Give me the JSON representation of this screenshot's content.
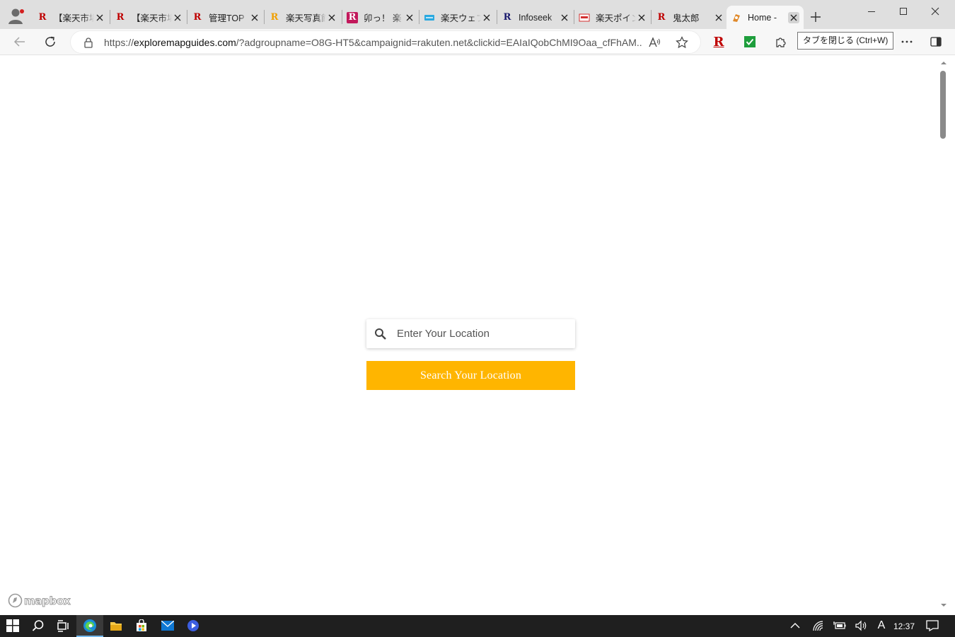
{
  "browser": {
    "tabs": [
      {
        "title": "【楽天市場】",
        "favicon": "rakuten-r-icon",
        "favicon_color": "#bf0000",
        "favicon_letter": "R"
      },
      {
        "title": "【楽天市場】",
        "favicon": "rakuten-r-icon",
        "favicon_color": "#bf0000",
        "favicon_letter": "R"
      },
      {
        "title": "管理TOP",
        "favicon": "rakuten-r-icon",
        "favicon_color": "#bf0000",
        "favicon_letter": "R"
      },
      {
        "title": "楽天写真館",
        "favicon": "rakuten-r-orange-icon",
        "favicon_color": "#f0a000",
        "favicon_letter": "R"
      },
      {
        "title": "卯っ！ 楽",
        "favicon": "rakuten-r-pink-icon",
        "favicon_color": "#c2185b",
        "favicon_letter": "R"
      },
      {
        "title": "楽天ウェブ",
        "favicon": "rakuten-web-icon",
        "favicon_color": "#2aa9e0",
        "favicon_letter": ""
      },
      {
        "title": "Infoseek",
        "favicon": "infoseek-r-icon",
        "favicon_color": "#1a1a6e",
        "favicon_letter": "R"
      },
      {
        "title": "楽天ポイント",
        "favicon": "rakuten-point-icon",
        "favicon_color": "#d32f2f",
        "favicon_letter": ""
      },
      {
        "title": "鬼太郎",
        "favicon": "rakuten-r-icon",
        "favicon_color": "#bf0000",
        "favicon_letter": "R"
      },
      {
        "title": "Home -",
        "favicon": "map-pin-icon",
        "favicon_color": "#e08a2c",
        "favicon_letter": "",
        "active": true
      }
    ],
    "address": {
      "host": "exploremapguides.com",
      "prefix": "https://",
      "rest": "/?adgroupname=O8G-HT5&campaignid=rakuten.net&clickid=EAIaIQobChMI9Oaa_cfFhAM..."
    },
    "tooltip": "タブを閉じる (Ctrl+W)",
    "accent_colors": {
      "rakuten_red": "#bf0000",
      "check_green": "#1e9e3c"
    }
  },
  "page": {
    "search_placeholder": "Enter Your Location",
    "search_button_label": "Search Your Location",
    "button_color": "#ffb500",
    "attribution": "mapbox"
  },
  "taskbar": {
    "clock": "12:37",
    "ime_indicator": "A"
  }
}
